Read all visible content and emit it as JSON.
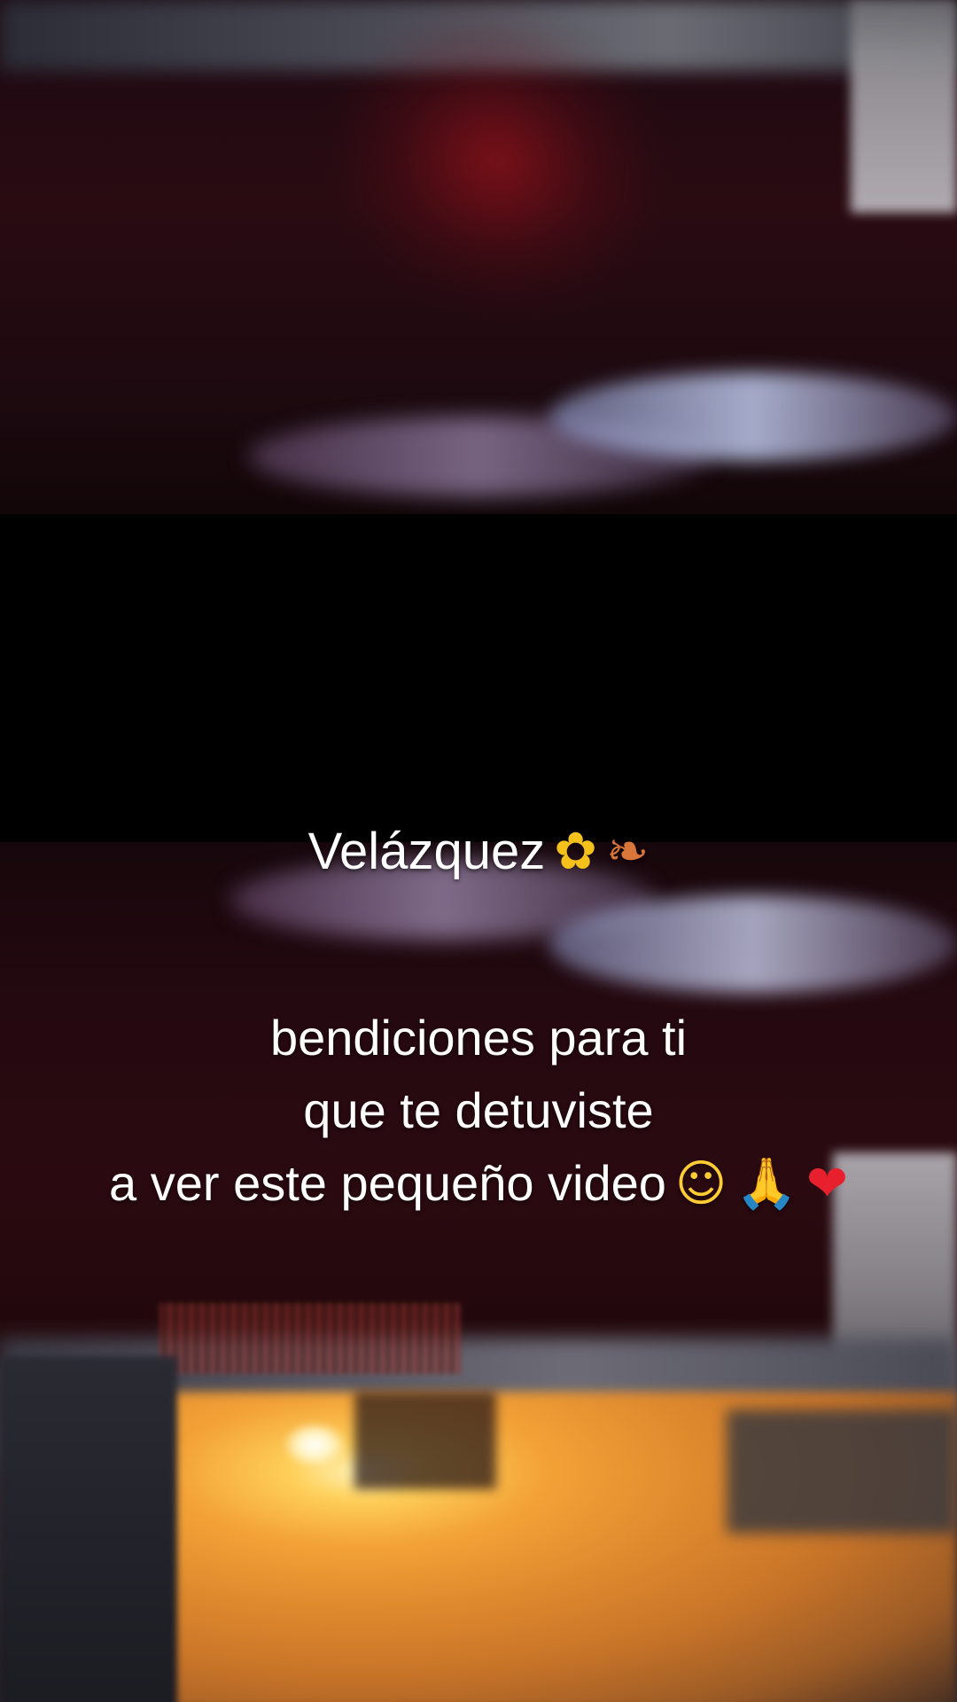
{
  "caption": {
    "title_text": "Velázquez",
    "title_icons": [
      {
        "name": "sunflower-icon",
        "glyph": "✿",
        "color": "#f4c21a"
      },
      {
        "name": "fallen-leaves-icon",
        "glyph": "❧",
        "color": "#d9763a"
      }
    ],
    "body_lines": [
      "bendiciones para ti",
      "que te detuviste",
      "a ver este pequeño video"
    ],
    "body_icons": [
      {
        "name": "smiling-face-icon",
        "glyph": "☺",
        "color": "#ffcc33"
      },
      {
        "name": "folded-hands-icon",
        "glyph": "🙏",
        "color": "#ffc64a"
      },
      {
        "name": "red-heart-icon",
        "glyph": "❤",
        "color": "#e8202e"
      }
    ]
  }
}
